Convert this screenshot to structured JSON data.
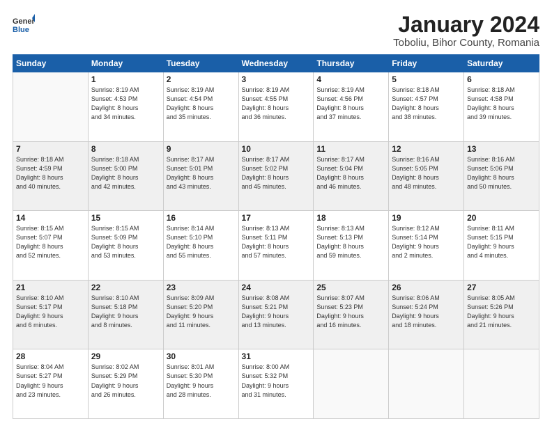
{
  "header": {
    "logo_general": "General",
    "logo_blue": "Blue",
    "title": "January 2024",
    "subtitle": "Toboliu, Bihor County, Romania"
  },
  "weekdays": [
    "Sunday",
    "Monday",
    "Tuesday",
    "Wednesday",
    "Thursday",
    "Friday",
    "Saturday"
  ],
  "weeks": [
    [
      {
        "day": null
      },
      {
        "day": 1,
        "sunrise": "8:19 AM",
        "sunset": "4:53 PM",
        "daylight": "8 hours and 34 minutes."
      },
      {
        "day": 2,
        "sunrise": "8:19 AM",
        "sunset": "4:54 PM",
        "daylight": "8 hours and 35 minutes."
      },
      {
        "day": 3,
        "sunrise": "8:19 AM",
        "sunset": "4:55 PM",
        "daylight": "8 hours and 36 minutes."
      },
      {
        "day": 4,
        "sunrise": "8:19 AM",
        "sunset": "4:56 PM",
        "daylight": "8 hours and 37 minutes."
      },
      {
        "day": 5,
        "sunrise": "8:18 AM",
        "sunset": "4:57 PM",
        "daylight": "8 hours and 38 minutes."
      },
      {
        "day": 6,
        "sunrise": "8:18 AM",
        "sunset": "4:58 PM",
        "daylight": "8 hours and 39 minutes."
      }
    ],
    [
      {
        "day": 7,
        "sunrise": "8:18 AM",
        "sunset": "4:59 PM",
        "daylight": "8 hours and 40 minutes."
      },
      {
        "day": 8,
        "sunrise": "8:18 AM",
        "sunset": "5:00 PM",
        "daylight": "8 hours and 42 minutes."
      },
      {
        "day": 9,
        "sunrise": "8:17 AM",
        "sunset": "5:01 PM",
        "daylight": "8 hours and 43 minutes."
      },
      {
        "day": 10,
        "sunrise": "8:17 AM",
        "sunset": "5:02 PM",
        "daylight": "8 hours and 45 minutes."
      },
      {
        "day": 11,
        "sunrise": "8:17 AM",
        "sunset": "5:04 PM",
        "daylight": "8 hours and 46 minutes."
      },
      {
        "day": 12,
        "sunrise": "8:16 AM",
        "sunset": "5:05 PM",
        "daylight": "8 hours and 48 minutes."
      },
      {
        "day": 13,
        "sunrise": "8:16 AM",
        "sunset": "5:06 PM",
        "daylight": "8 hours and 50 minutes."
      }
    ],
    [
      {
        "day": 14,
        "sunrise": "8:15 AM",
        "sunset": "5:07 PM",
        "daylight": "8 hours and 52 minutes."
      },
      {
        "day": 15,
        "sunrise": "8:15 AM",
        "sunset": "5:09 PM",
        "daylight": "8 hours and 53 minutes."
      },
      {
        "day": 16,
        "sunrise": "8:14 AM",
        "sunset": "5:10 PM",
        "daylight": "8 hours and 55 minutes."
      },
      {
        "day": 17,
        "sunrise": "8:13 AM",
        "sunset": "5:11 PM",
        "daylight": "8 hours and 57 minutes."
      },
      {
        "day": 18,
        "sunrise": "8:13 AM",
        "sunset": "5:13 PM",
        "daylight": "8 hours and 59 minutes."
      },
      {
        "day": 19,
        "sunrise": "8:12 AM",
        "sunset": "5:14 PM",
        "daylight": "9 hours and 2 minutes."
      },
      {
        "day": 20,
        "sunrise": "8:11 AM",
        "sunset": "5:15 PM",
        "daylight": "9 hours and 4 minutes."
      }
    ],
    [
      {
        "day": 21,
        "sunrise": "8:10 AM",
        "sunset": "5:17 PM",
        "daylight": "9 hours and 6 minutes."
      },
      {
        "day": 22,
        "sunrise": "8:10 AM",
        "sunset": "5:18 PM",
        "daylight": "9 hours and 8 minutes."
      },
      {
        "day": 23,
        "sunrise": "8:09 AM",
        "sunset": "5:20 PM",
        "daylight": "9 hours and 11 minutes."
      },
      {
        "day": 24,
        "sunrise": "8:08 AM",
        "sunset": "5:21 PM",
        "daylight": "9 hours and 13 minutes."
      },
      {
        "day": 25,
        "sunrise": "8:07 AM",
        "sunset": "5:23 PM",
        "daylight": "9 hours and 16 minutes."
      },
      {
        "day": 26,
        "sunrise": "8:06 AM",
        "sunset": "5:24 PM",
        "daylight": "9 hours and 18 minutes."
      },
      {
        "day": 27,
        "sunrise": "8:05 AM",
        "sunset": "5:26 PM",
        "daylight": "9 hours and 21 minutes."
      }
    ],
    [
      {
        "day": 28,
        "sunrise": "8:04 AM",
        "sunset": "5:27 PM",
        "daylight": "9 hours and 23 minutes."
      },
      {
        "day": 29,
        "sunrise": "8:02 AM",
        "sunset": "5:29 PM",
        "daylight": "9 hours and 26 minutes."
      },
      {
        "day": 30,
        "sunrise": "8:01 AM",
        "sunset": "5:30 PM",
        "daylight": "9 hours and 28 minutes."
      },
      {
        "day": 31,
        "sunrise": "8:00 AM",
        "sunset": "5:32 PM",
        "daylight": "9 hours and 31 minutes."
      },
      {
        "day": null
      },
      {
        "day": null
      },
      {
        "day": null
      }
    ]
  ],
  "labels": {
    "sunrise": "Sunrise:",
    "sunset": "Sunset:",
    "daylight": "Daylight:"
  }
}
